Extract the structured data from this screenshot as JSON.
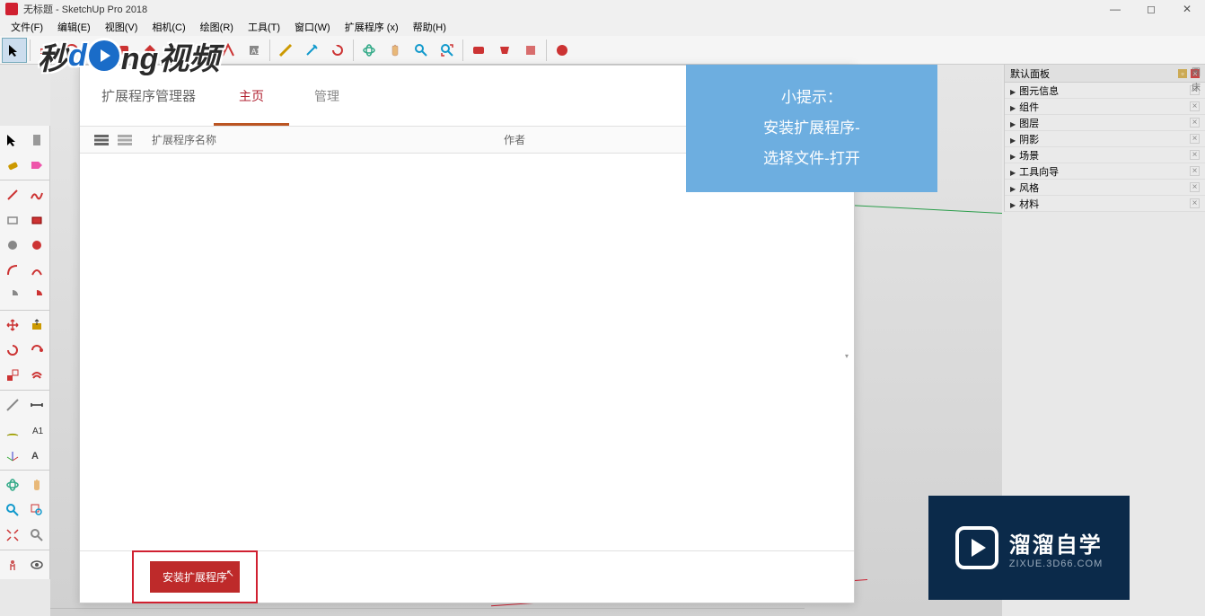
{
  "window": {
    "title": "无标题 - SketchUp Pro 2018"
  },
  "menu": [
    "文件(F)",
    "编辑(E)",
    "视图(V)",
    "相机(C)",
    "绘图(R)",
    "工具(T)",
    "窗口(W)",
    "扩展程序 (x)",
    "帮助(H)"
  ],
  "ext_manager": {
    "title": "扩展程序管理器",
    "tab_home": "主页",
    "tab_manage": "管理",
    "col_name": "扩展程序名称",
    "col_author": "作者",
    "install_btn": "安装扩展程序"
  },
  "tip": {
    "line1": "小提示：",
    "line2": "安装扩展程序-",
    "line3": "选择文件-打开"
  },
  "right_panel": {
    "title": "默认面板",
    "items": [
      "图元信息",
      "组件",
      "图层",
      "阴影",
      "场景",
      "工具向导",
      "风格",
      "材料"
    ]
  },
  "watermark_left": {
    "t1": "秒",
    "t2": "ng视频"
  },
  "watermark_right": {
    "t1": "溜溜自学",
    "t2": "ZIXUE.3D66.COM"
  }
}
